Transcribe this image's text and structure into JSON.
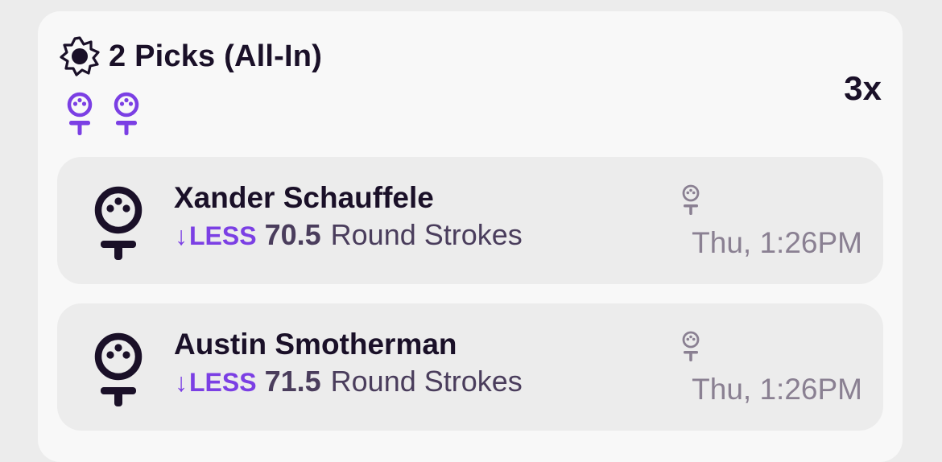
{
  "header": {
    "title": "2 Picks (All-In)",
    "multiplier": "3x",
    "icon": "sun-badge-icon",
    "pick_icons": [
      "golf-ball-tee-icon",
      "golf-ball-tee-icon"
    ]
  },
  "picks": [
    {
      "player": "Xander Schauffele",
      "arrow": "↓",
      "direction": "LESS",
      "line": "70.5",
      "stat": "Round Strokes",
      "time": "Thu, 1:26PM",
      "icon": "golf-ball-tee-icon"
    },
    {
      "player": "Austin Smotherman",
      "arrow": "↓",
      "direction": "LESS",
      "line": "71.5",
      "stat": "Round Strokes",
      "time": "Thu, 1:26PM",
      "icon": "golf-ball-tee-icon"
    }
  ],
  "colors": {
    "accent": "#7b3fe4",
    "text_dark": "#1a1028",
    "text_muted": "#8a8092",
    "card_bg": "#f8f8f8",
    "pick_bg": "#ececec"
  }
}
